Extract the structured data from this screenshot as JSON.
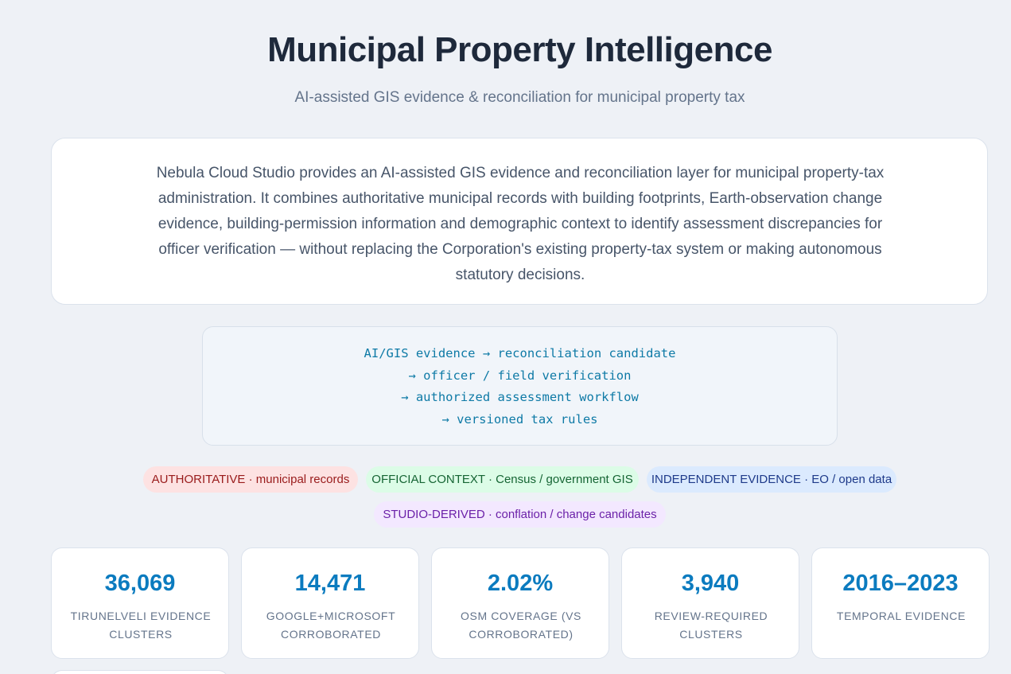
{
  "header": {
    "title": "Municipal Property Intelligence",
    "subtitle": "AI-assisted GIS evidence & reconciliation for municipal property tax"
  },
  "intro": {
    "text": "Nebula Cloud Studio provides an AI-assisted GIS evidence and reconciliation layer for municipal property-tax administration. It combines authoritative municipal records with building footprints, Earth-observation change evidence, building-permission information and demographic context to identify assessment discrepancies for officer verification — without replacing the Corporation's existing property-tax system or making autonomous statutory decisions."
  },
  "flow": {
    "lines": [
      "AI/GIS evidence → reconciliation candidate",
      "→ officer / field verification",
      "→ authorized assessment workflow",
      "→ versioned tax rules"
    ]
  },
  "badges": [
    {
      "label": "AUTHORITATIVE · municipal records",
      "color": "#991b1b",
      "background": "#fde2e2"
    },
    {
      "label": "OFFICIAL CONTEXT · Census / government GIS",
      "color": "#166534",
      "background": "#dcfce7"
    },
    {
      "label": "INDEPENDENT EVIDENCE · EO / open data",
      "color": "#1e3a8a",
      "background": "#dbeafe"
    },
    {
      "label": "STUDIO-DERIVED · conflation / change candidates",
      "color": "#6b21a8",
      "background": "#f3e8ff"
    }
  ],
  "stats": [
    {
      "value": "36,069",
      "label": "TIRUNELVELI EVIDENCE CLUSTERS"
    },
    {
      "value": "14,471",
      "label": "GOOGLE+MICROSOFT CORROBORATED"
    },
    {
      "value": "2.02%",
      "label": "OSM COVERAGE (VS CORROBORATED)"
    },
    {
      "value": "3,940",
      "label": "REVIEW-REQUIRED CLUSTERS"
    },
    {
      "value": "2016–2023",
      "label": "TEMPORAL EVIDENCE"
    }
  ],
  "colors": {
    "accent": "#0b7bbf",
    "background": "#eef1f6",
    "flow_text": "#0e7aa6"
  }
}
